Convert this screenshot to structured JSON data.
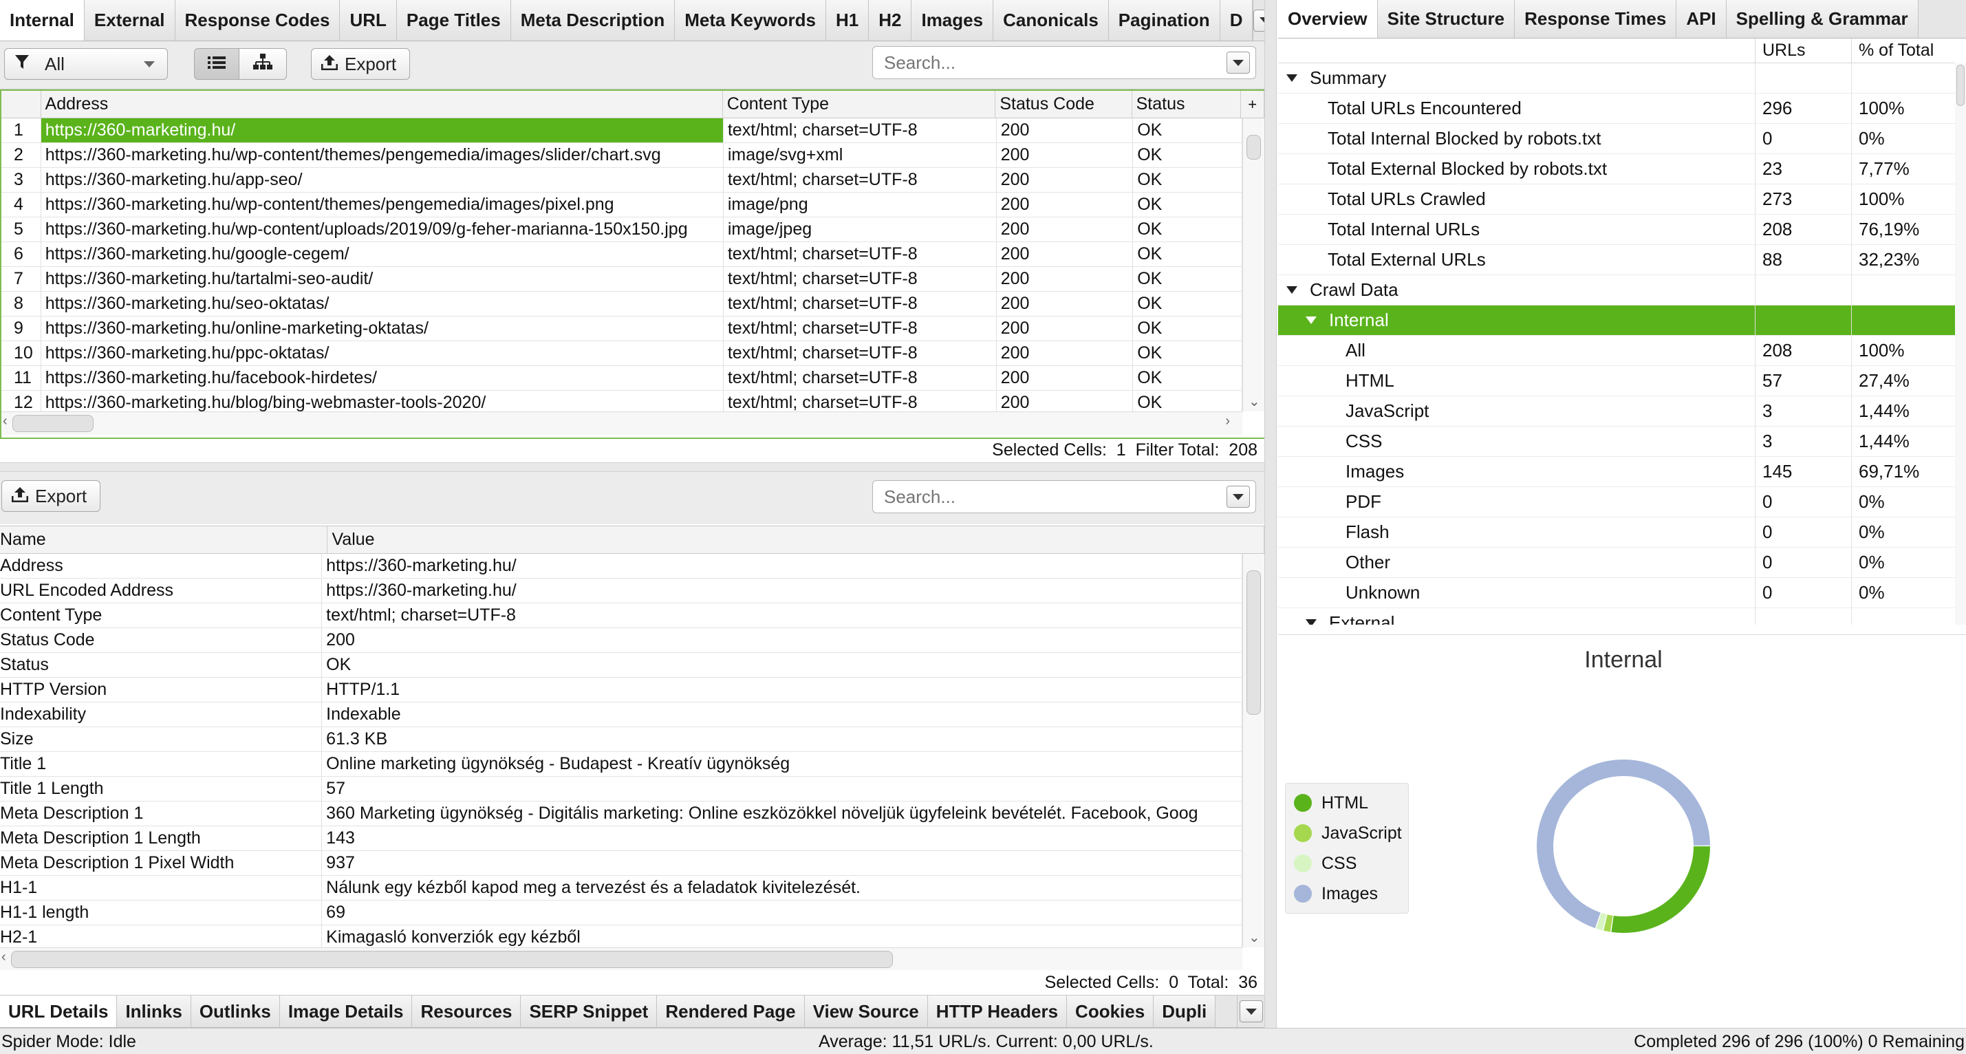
{
  "top_tabs": [
    "Internal",
    "External",
    "Response Codes",
    "URL",
    "Page Titles",
    "Meta Description",
    "Meta Keywords",
    "H1",
    "H2",
    "Images",
    "Canonicals",
    "Pagination",
    "D"
  ],
  "toolbar": {
    "filter_value": "All",
    "export_label": "Export",
    "search_placeholder": "Search..."
  },
  "main_table": {
    "columns": [
      "Address",
      "Content Type",
      "Status Code",
      "Status"
    ],
    "rows": [
      [
        "1",
        "https://360-marketing.hu/",
        "text/html; charset=UTF-8",
        "200",
        "OK"
      ],
      [
        "2",
        "https://360-marketing.hu/wp-content/themes/pengemedia/images/slider/chart.svg",
        "image/svg+xml",
        "200",
        "OK"
      ],
      [
        "3",
        "https://360-marketing.hu/app-seo/",
        "text/html; charset=UTF-8",
        "200",
        "OK"
      ],
      [
        "4",
        "https://360-marketing.hu/wp-content/themes/pengemedia/images/pixel.png",
        "image/png",
        "200",
        "OK"
      ],
      [
        "5",
        "https://360-marketing.hu/wp-content/uploads/2019/09/g-feher-marianna-150x150.jpg",
        "image/jpeg",
        "200",
        "OK"
      ],
      [
        "6",
        "https://360-marketing.hu/google-cegem/",
        "text/html; charset=UTF-8",
        "200",
        "OK"
      ],
      [
        "7",
        "https://360-marketing.hu/tartalmi-seo-audit/",
        "text/html; charset=UTF-8",
        "200",
        "OK"
      ],
      [
        "8",
        "https://360-marketing.hu/seo-oktatas/",
        "text/html; charset=UTF-8",
        "200",
        "OK"
      ],
      [
        "9",
        "https://360-marketing.hu/online-marketing-oktatas/",
        "text/html; charset=UTF-8",
        "200",
        "OK"
      ],
      [
        "10",
        "https://360-marketing.hu/ppc-oktatas/",
        "text/html; charset=UTF-8",
        "200",
        "OK"
      ],
      [
        "11",
        "https://360-marketing.hu/facebook-hirdetes/",
        "text/html; charset=UTF-8",
        "200",
        "OK"
      ],
      [
        "12",
        "https://360-marketing.hu/blog/bing-webmaster-tools-2020/",
        "text/html; charset=UTF-8",
        "200",
        "OK"
      ]
    ],
    "footer": "Selected Cells:  1  Filter Total:  208"
  },
  "detail": {
    "export_label": "Export",
    "search_placeholder": "Search...",
    "columns": [
      "Name",
      "Value"
    ],
    "rows": [
      [
        "Address",
        "https://360-marketing.hu/"
      ],
      [
        "URL Encoded Address",
        "https://360-marketing.hu/"
      ],
      [
        "Content Type",
        "text/html; charset=UTF-8"
      ],
      [
        "Status Code",
        "200"
      ],
      [
        "Status",
        "OK"
      ],
      [
        "HTTP Version",
        "HTTP/1.1"
      ],
      [
        "Indexability",
        "Indexable"
      ],
      [
        "Size",
        "61.3 KB"
      ],
      [
        "Title 1",
        "Online marketing ügynökség - Budapest - Kreatív ügynökség"
      ],
      [
        "Title 1 Length",
        "57"
      ],
      [
        "Meta Description 1",
        "360 Marketing ügynökség - Digitális marketing: Online eszközökkel növeljük ügyfeleink bevételét. Facebook, Goog"
      ],
      [
        "Meta Description 1 Length",
        "143"
      ],
      [
        "Meta Description 1 Pixel Width",
        "937"
      ],
      [
        "H1-1",
        "Nálunk egy kézből kapod meg a tervezést és a feladatok kivitelezését."
      ],
      [
        "H1-1 length",
        "69"
      ],
      [
        "H2-1",
        "Kimagasló konverziók egy kézből"
      ]
    ],
    "footer": "Selected Cells:  0  Total:  36"
  },
  "bottom_tabs": [
    "URL Details",
    "Inlinks",
    "Outlinks",
    "Image Details",
    "Resources",
    "SERP Snippet",
    "Rendered Page",
    "View Source",
    "HTTP Headers",
    "Cookies",
    "Dupli"
  ],
  "right_tabs": [
    "Overview",
    "Site Structure",
    "Response Times",
    "API",
    "Spelling & Grammar"
  ],
  "overview": {
    "col_urls": "URLs",
    "col_pct": "% of Total",
    "rows": [
      {
        "label": "Summary",
        "urls": "",
        "pct": "",
        "level": 0,
        "toggle": true,
        "sel": false
      },
      {
        "label": "Total URLs Encountered",
        "urls": "296",
        "pct": "100%",
        "level": 1,
        "toggle": false,
        "sel": false
      },
      {
        "label": "Total Internal Blocked by robots.txt",
        "urls": "0",
        "pct": "0%",
        "level": 1,
        "toggle": false,
        "sel": false
      },
      {
        "label": "Total External Blocked by robots.txt",
        "urls": "23",
        "pct": "7,77%",
        "level": 1,
        "toggle": false,
        "sel": false
      },
      {
        "label": "Total URLs Crawled",
        "urls": "273",
        "pct": "100%",
        "level": 1,
        "toggle": false,
        "sel": false
      },
      {
        "label": "Total Internal URLs",
        "urls": "208",
        "pct": "76,19%",
        "level": 1,
        "toggle": false,
        "sel": false
      },
      {
        "label": "Total External URLs",
        "urls": "88",
        "pct": "32,23%",
        "level": 1,
        "toggle": false,
        "sel": false
      },
      {
        "label": "Crawl Data",
        "urls": "",
        "pct": "",
        "level": 0,
        "toggle": true,
        "sel": false
      },
      {
        "label": "Internal",
        "urls": "",
        "pct": "",
        "level": 1,
        "toggle": true,
        "sel": true
      },
      {
        "label": "All",
        "urls": "208",
        "pct": "100%",
        "level": 2,
        "toggle": false,
        "sel": false
      },
      {
        "label": "HTML",
        "urls": "57",
        "pct": "27,4%",
        "level": 2,
        "toggle": false,
        "sel": false
      },
      {
        "label": "JavaScript",
        "urls": "3",
        "pct": "1,44%",
        "level": 2,
        "toggle": false,
        "sel": false
      },
      {
        "label": "CSS",
        "urls": "3",
        "pct": "1,44%",
        "level": 2,
        "toggle": false,
        "sel": false
      },
      {
        "label": "Images",
        "urls": "145",
        "pct": "69,71%",
        "level": 2,
        "toggle": false,
        "sel": false
      },
      {
        "label": "PDF",
        "urls": "0",
        "pct": "0%",
        "level": 2,
        "toggle": false,
        "sel": false
      },
      {
        "label": "Flash",
        "urls": "0",
        "pct": "0%",
        "level": 2,
        "toggle": false,
        "sel": false
      },
      {
        "label": "Other",
        "urls": "0",
        "pct": "0%",
        "level": 2,
        "toggle": false,
        "sel": false
      },
      {
        "label": "Unknown",
        "urls": "0",
        "pct": "0%",
        "level": 2,
        "toggle": false,
        "sel": false
      },
      {
        "label": "External",
        "urls": "",
        "pct": "",
        "level": 1,
        "toggle": true,
        "sel": false
      }
    ]
  },
  "chart_data": {
    "type": "pie",
    "title": "Internal",
    "donut": true,
    "categories": [
      "HTML",
      "JavaScript",
      "CSS",
      "Images"
    ],
    "values": [
      57,
      3,
      3,
      145
    ],
    "colors": [
      "#5ab31b",
      "#a5d84e",
      "#d7f5c3",
      "#a5b6da"
    ],
    "legend_position": "left"
  },
  "statusbar": {
    "mode": "Spider Mode: Idle",
    "average": "Average: 11,51 URL/s. Current: 0,00 URL/s.",
    "completed": "Completed 296 of 296 (100%) 0 Remaining"
  }
}
